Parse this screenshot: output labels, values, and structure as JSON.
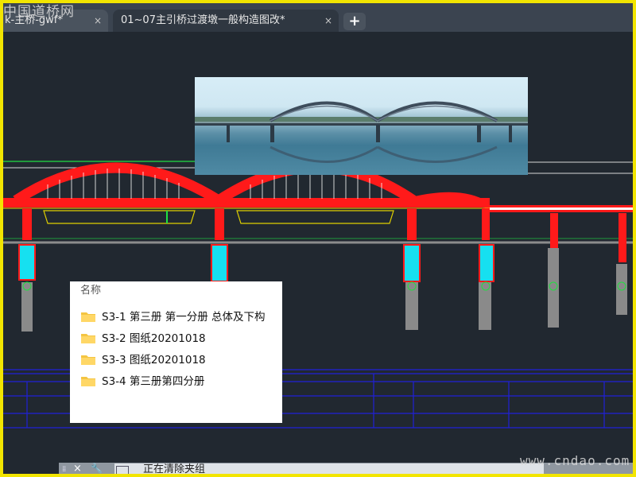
{
  "watermarks": {
    "top": "中国道桥网",
    "bottom": "www.cndao.com"
  },
  "tabs": [
    {
      "label": "k-主桥-gwf*",
      "close": "×",
      "active": false
    },
    {
      "label": "01~07主引桥过渡墩一般构造图改*",
      "close": "×",
      "active": true
    }
  ],
  "add_tab_label": "+",
  "photo": {
    "subject": "arch-bridge-reflection-photo"
  },
  "file_panel": {
    "column_header": "名称",
    "items": [
      {
        "name": "S3-1 第三册 第一分册 总体及下构",
        "icon": "folder-icon"
      },
      {
        "name": "S3-2 图纸20201018",
        "icon": "folder-icon"
      },
      {
        "name": "S3-3 图纸20201018",
        "icon": "folder-icon"
      },
      {
        "name": "S3-4 第三册第四分册",
        "icon": "folder-icon"
      }
    ]
  },
  "command_line": {
    "text": "正在清除夹组",
    "close_icon": "×",
    "tool_icon": "wrench-icon"
  },
  "colors": {
    "canvas": "#212830",
    "frame": "#f2e500",
    "bridge": "#ff1a1a",
    "pier": "#16e0f0",
    "blue_lines": "#2020d8",
    "green_lines": "#20c040"
  }
}
